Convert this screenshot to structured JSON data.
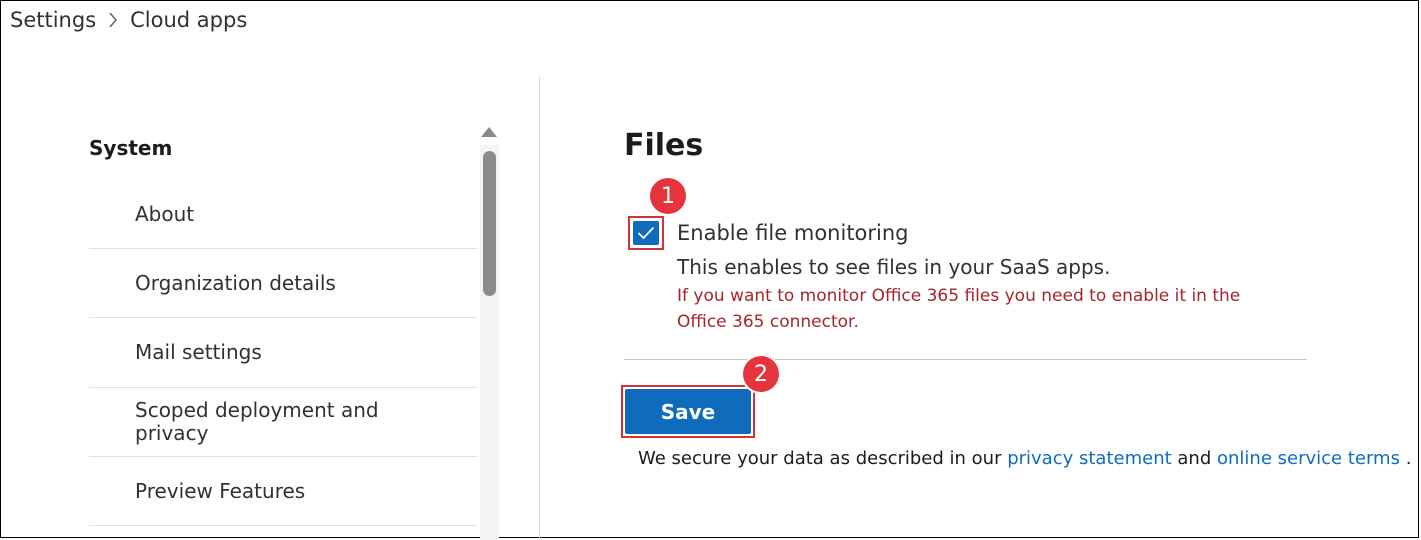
{
  "breadcrumb": {
    "root": "Settings",
    "current": "Cloud apps"
  },
  "nav": {
    "heading": "System",
    "items": [
      {
        "label": "About"
      },
      {
        "label": "Organization details"
      },
      {
        "label": "Mail settings"
      },
      {
        "label": "Scoped deployment and privacy"
      },
      {
        "label": "Preview Features"
      }
    ]
  },
  "content": {
    "title": "Files",
    "checkbox": {
      "label": "Enable file monitoring",
      "checked": true,
      "description": "This enables to see files in your SaaS apps.",
      "warning": "If you want to monitor Office 365 files you need to enable it in the Office 365 connector."
    },
    "save_label": "Save",
    "footer": {
      "prefix": "We secure your data as described in our",
      "privacy_link": "privacy statement",
      "and": "and",
      "terms_link": "online service terms",
      "suffix": "."
    }
  },
  "annotations": {
    "step1": "1",
    "step2": "2"
  },
  "colors": {
    "accent": "#0f6cbd",
    "highlight": "#d13438",
    "badge": "#e5343c",
    "warning": "#a4262c"
  }
}
